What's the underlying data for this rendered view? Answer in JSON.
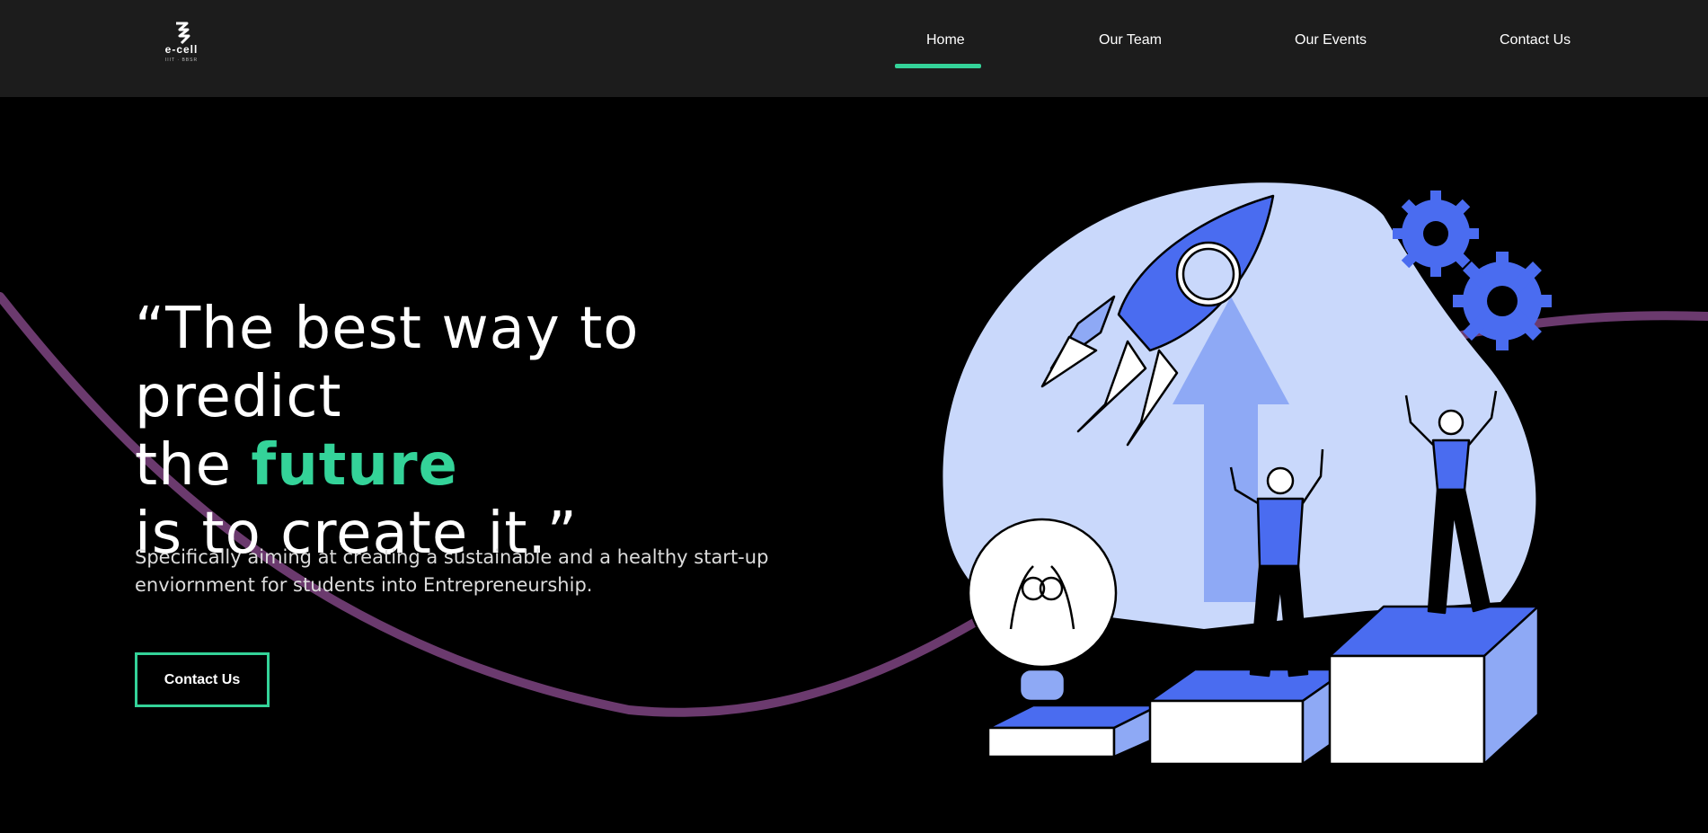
{
  "brand": {
    "logo_text": "e-cell",
    "logo_sub": "IIIT · BBSR"
  },
  "nav": {
    "items": [
      {
        "label": "Home",
        "active": true
      },
      {
        "label": "Our Team",
        "active": false
      },
      {
        "label": "Our Events",
        "active": false
      },
      {
        "label": "Contact Us",
        "active": false
      }
    ]
  },
  "hero": {
    "quote_open": "“The best way to predict",
    "quote_the": "the ",
    "quote_highlight": "future",
    "quote_close": "is to create it.”",
    "description": "Specifically aiming at creating a sustainable and a healthy start-up enviornment for students into Entrepreneurship.",
    "cta_label": "Contact Us"
  },
  "colors": {
    "accent": "#34d399",
    "nav_bg": "#1c1c1c",
    "page_bg": "#000000",
    "wave": "#6b3a6e",
    "illustration_blue": "#4a6cf0",
    "illustration_light": "#c9d8fb"
  },
  "illustration": {
    "icons": [
      "rocket-icon",
      "lightbulb-icon",
      "gear-icon",
      "arrow-up-icon",
      "podium-icon",
      "person-icon"
    ]
  }
}
